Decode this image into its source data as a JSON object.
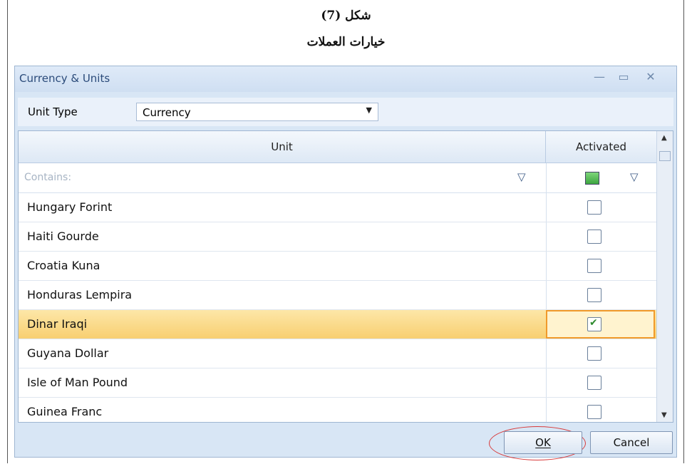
{
  "captions": {
    "line1": "شكل (7)",
    "line2": "خيارات العملات"
  },
  "window": {
    "title": "Currency & Units",
    "controls": {
      "minimize": "—",
      "maximize": "▭",
      "close": "✕"
    }
  },
  "unit_type": {
    "label": "Unit Type",
    "selected": "Currency"
  },
  "grid": {
    "columns": [
      "Unit",
      "Activated"
    ],
    "filter_placeholder": "Contains:",
    "rows": [
      {
        "unit": "Hungary Forint",
        "activated": false,
        "selected": false
      },
      {
        "unit": "Haiti Gourde",
        "activated": false,
        "selected": false
      },
      {
        "unit": "Croatia Kuna",
        "activated": false,
        "selected": false
      },
      {
        "unit": "Honduras Lempira",
        "activated": false,
        "selected": false
      },
      {
        "unit": "Dinar Iraqi",
        "activated": true,
        "selected": true
      },
      {
        "unit": "Guyana Dollar",
        "activated": false,
        "selected": false
      },
      {
        "unit": "Isle of Man Pound",
        "activated": false,
        "selected": false
      },
      {
        "unit": "Guinea Franc",
        "activated": false,
        "selected": false
      }
    ]
  },
  "buttons": {
    "ok": "OK",
    "cancel": "Cancel"
  },
  "colors": {
    "selected_row": "#f8cf71",
    "highlight_border": "#f19a2a",
    "annotation_oval": "#d83a3a"
  }
}
